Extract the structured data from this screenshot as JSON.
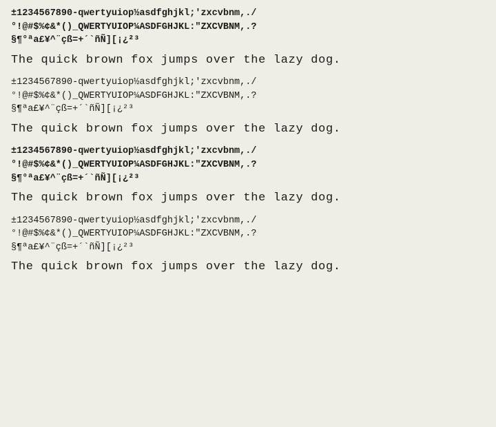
{
  "blocks": [
    {
      "id": "block1",
      "charset1": "±1234567890-qwertyuiop½asdfghjkl;'zxcvbnm,./",
      "charset2": "°!@#$%¢&*()_QWERTYUIOP¼ASDFGHJKL:\"ZXCVBNM,.?",
      "charset3": "§¶°ªa£¥^¨çß=+´`ñÑ][¡¿²³",
      "pangram": "The quick brown fox jumps over the lazy dog.",
      "bold": true
    },
    {
      "id": "block2",
      "charset1": "±1234567890-qwertyuiop½asdfghjkl;'zxcvbnm,./",
      "charset2": "°!@#$%¢&*()_QWERTYUIOP¼ASDFGHJKL:\"ZXCVBNM,.?",
      "charset3": "§¶ªa£¥^¨çß=+´`ñÑ][¡¿²³",
      "pangram": "The quick brown fox jumps over the lazy dog.",
      "bold": false
    },
    {
      "id": "block3",
      "charset1": "±1234567890-qwertyuiop½asdfghjkl;'zxcvbnm,./",
      "charset2": "°!@#$%¢&*()_QWERTYUIOP¼ASDFGHJKL:\"ZXCVBNM,.?",
      "charset3": "§¶°ªa£¥^¨çß=+´`ñÑ][¡¿²³",
      "pangram": "The quick brown fox jumps over the lazy dog.",
      "bold": true
    },
    {
      "id": "block4",
      "charset1": "±1234567890-qwertyuiop½asdfghjkl;'zxcvbnm,./",
      "charset2": "°!@#$%¢&*()_QWERTYUIOP¼ASDFGHJKL:\"ZXCVBNM,.?",
      "charset3": "§¶ªa£¥^¨çß=+´`ñÑ][¡¿²³",
      "pangram": "The quick brown fox jumps over the lazy dog.",
      "bold": false
    }
  ]
}
